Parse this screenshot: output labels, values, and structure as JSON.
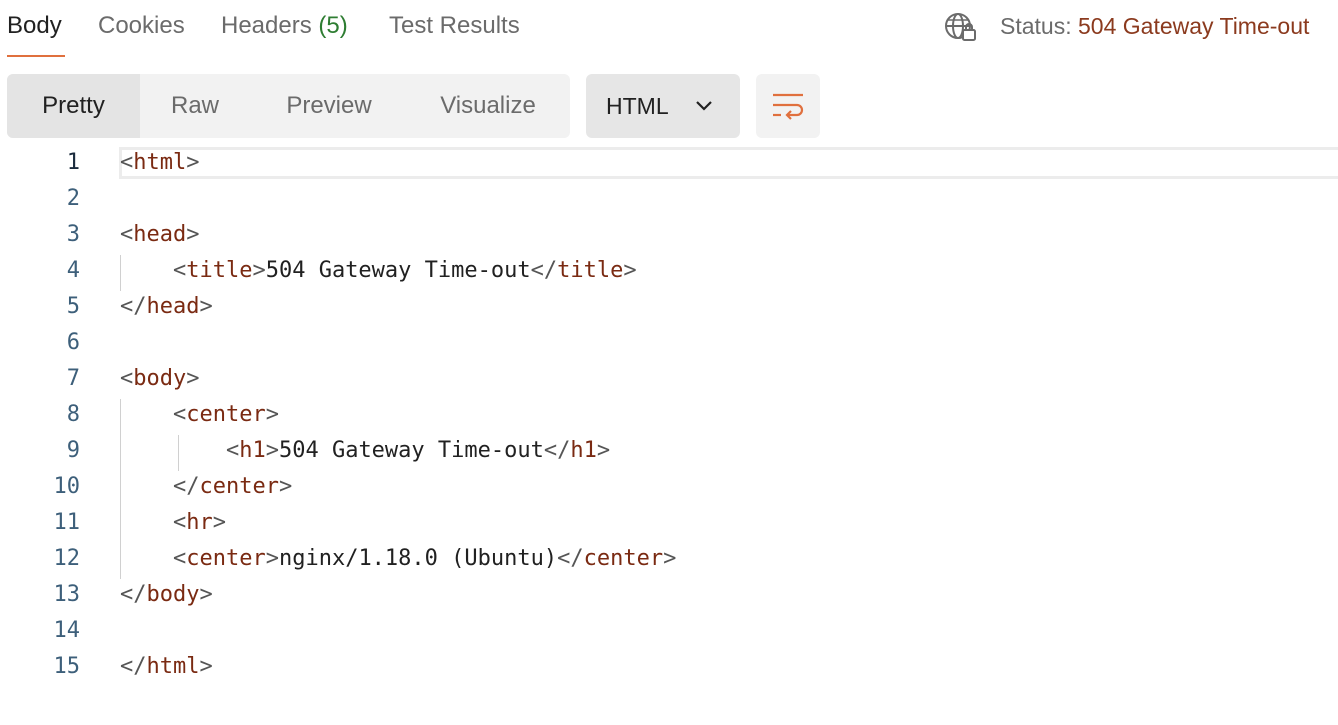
{
  "response_tabs": {
    "body": "Body",
    "cookies": "Cookies",
    "headers_label": "Headers",
    "headers_count": "(5)",
    "test_results": "Test Results"
  },
  "status": {
    "label": "Status:",
    "value": "504 Gateway Time-out"
  },
  "view_modes": {
    "pretty": "Pretty",
    "raw": "Raw",
    "preview": "Preview",
    "visualize": "Visualize"
  },
  "format_select": {
    "value": "HTML"
  },
  "icons": {
    "network": "globe-lock-icon",
    "dropdown": "chevron-down-icon",
    "wrap": "wrap-lines-icon"
  },
  "colors": {
    "accent": "#e0703e",
    "status_value": "#8b3a1e",
    "tag": "#7a2a12",
    "line_number": "#3d5f7a"
  },
  "editor": {
    "line_numbers": [
      "1",
      "2",
      "3",
      "4",
      "5",
      "6",
      "7",
      "8",
      "9",
      "10",
      "11",
      "12",
      "13",
      "14",
      "15"
    ],
    "lines": [
      "<html>",
      "",
      "<head>",
      "    <title>504 Gateway Time-out</title>",
      "</head>",
      "",
      "<body>",
      "    <center>",
      "        <h1>504 Gateway Time-out</h1>",
      "    </center>",
      "    <hr>",
      "    <center>nginx/1.18.0 (Ubuntu)</center>",
      "</body>",
      "",
      "</html>"
    ]
  }
}
